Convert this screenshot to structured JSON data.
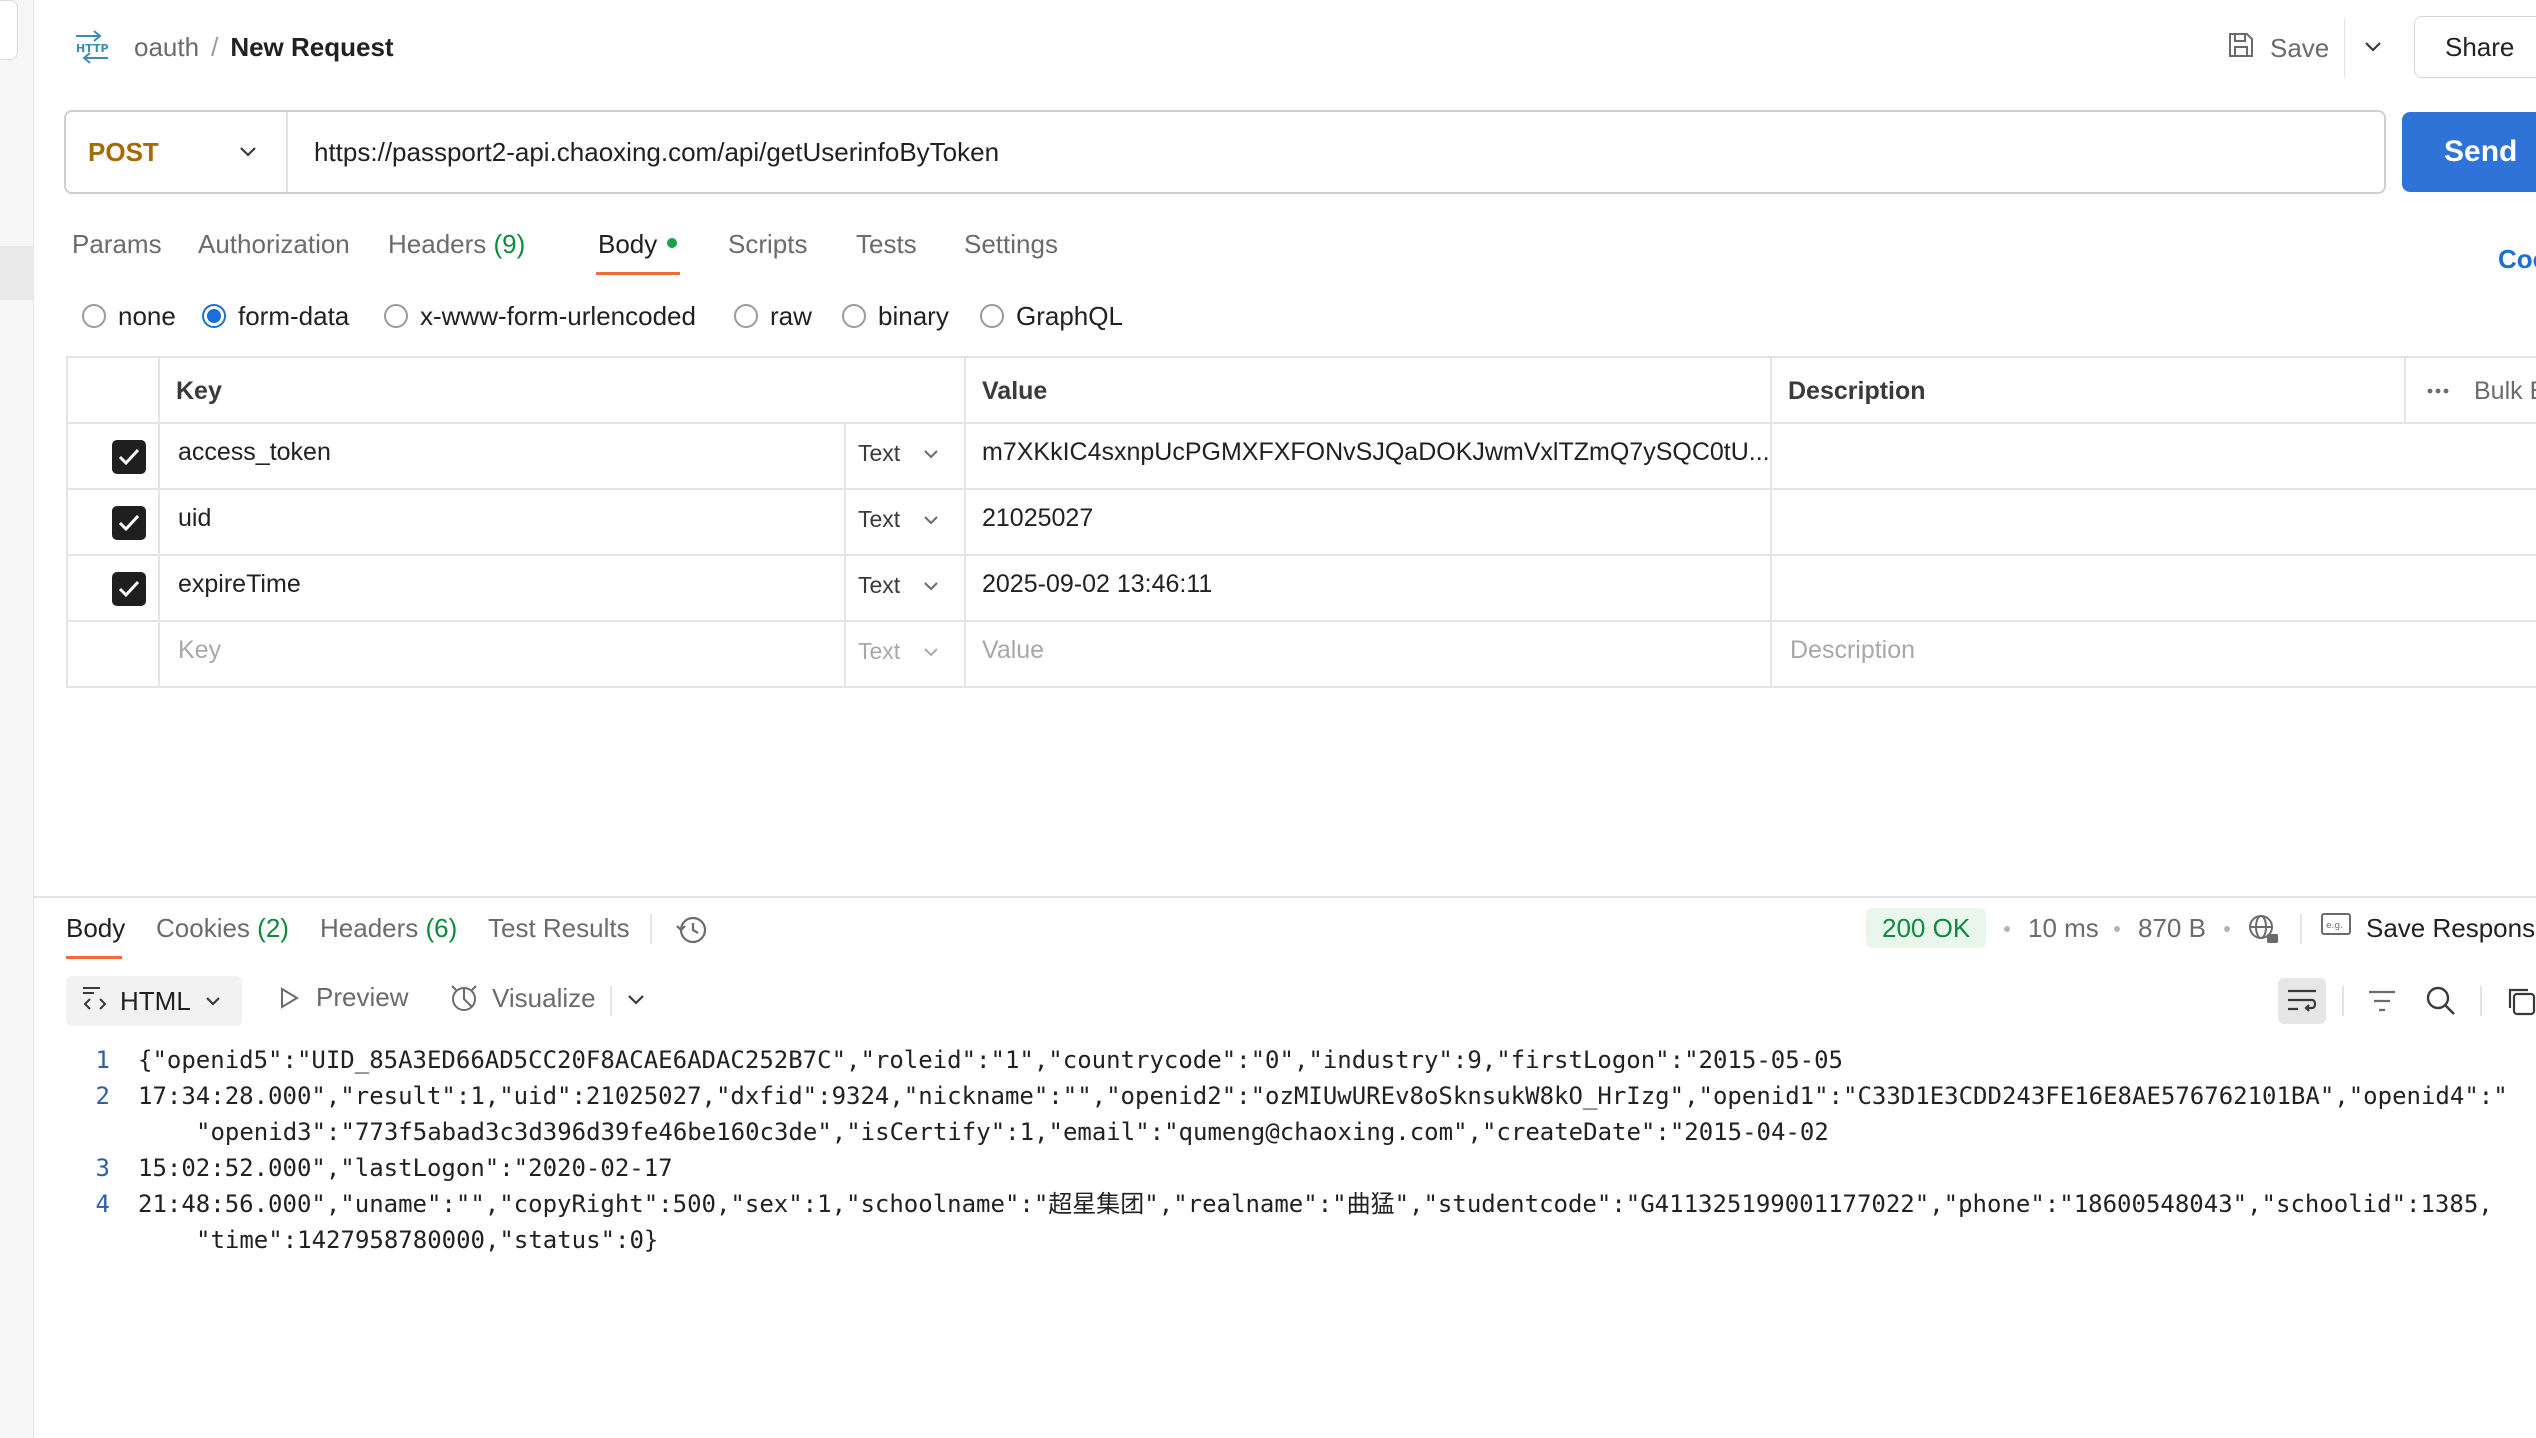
{
  "header": {
    "collection": "oauth",
    "separator": "/",
    "request_name": "New Request",
    "save_label": "Save",
    "share_label": "Share"
  },
  "request": {
    "method": "POST",
    "url": "https://passport2-api.chaoxing.com/api/getUserinfoByToken",
    "send_label": "Send"
  },
  "request_tabs": [
    {
      "label": "Params"
    },
    {
      "label": "Authorization"
    },
    {
      "label": "Headers",
      "count": "(9)"
    },
    {
      "label": "Body"
    },
    {
      "label": "Scripts"
    },
    {
      "label": "Tests"
    },
    {
      "label": "Settings"
    }
  ],
  "cookies_link": "Coo",
  "body_types": [
    "none",
    "form-data",
    "x-www-form-urlencoded",
    "raw",
    "binary",
    "GraphQL"
  ],
  "form_table": {
    "headers": {
      "key": "Key",
      "value": "Value",
      "description": "Description",
      "bulk_edit": "Bulk E"
    },
    "rows": [
      {
        "checked": true,
        "key": "access_token",
        "type": "Text",
        "value": "m7XKkIC4sxnpUcPGMXFXFONvSJQaDOKJwmVxlTZmQ7ySQC0tU..."
      },
      {
        "checked": true,
        "key": "uid",
        "type": "Text",
        "value": "21025027"
      },
      {
        "checked": true,
        "key": "expireTime",
        "type": "Text",
        "value": "2025-09-02 13:46:11"
      }
    ],
    "placeholder": {
      "key": "Key",
      "type": "Text",
      "value": "Value",
      "description": "Description"
    }
  },
  "response": {
    "tabs": [
      {
        "label": "Body"
      },
      {
        "label": "Cookies",
        "count": "(2)"
      },
      {
        "label": "Headers",
        "count": "(6)"
      },
      {
        "label": "Test Results"
      }
    ],
    "status": "200 OK",
    "time": "10 ms",
    "size": "870 B",
    "save_response_label": "Save Response",
    "format": "HTML",
    "preview_label": "Preview",
    "visualize_label": "Visualize",
    "lines": [
      {
        "n": "1",
        "text": "{\"openid5\":\"UID_85A3ED66AD5CC20F8ACAE6ADAC252B7C\",\"roleid\":\"1\",\"countrycode\":\"0\",\"industry\":9,\"firstLogon\":\"2015-05-05"
      },
      {
        "n": "2",
        "text": "17:34:28.000\",\"result\":1,\"uid\":21025027,\"dxfid\":9324,\"nickname\":\"\",\"openid2\":\"ozMIUwUREv8oSknsukW8kO_HrIzg\",\"openid1\":\"C33D1E3CDD243FE16E8AE576762101BA\",\"openid4\":\""
      },
      {
        "n": "",
        "text": "\"openid3\":\"773f5abad3c3d396d39fe46be160c3de\",\"isCertify\":1,\"email\":\"qumeng@chaoxing.com\",\"createDate\":\"2015-04-02"
      },
      {
        "n": "3",
        "text": "15:02:52.000\",\"lastLogon\":\"2020-02-17"
      },
      {
        "n": "4",
        "text": "21:48:56.000\",\"uname\":\"\",\"copyRight\":500,\"sex\":1,\"schoolname\":\"超星集团\",\"realname\":\"曲猛\",\"studentcode\":\"G411325199001177022\",\"phone\":\"18600548043\",\"schoolid\":1385,"
      },
      {
        "n": "",
        "text": "\"time\":1427958780000,\"status\":0}"
      }
    ]
  },
  "colors": {
    "accent": "#2f73d9",
    "method": "#a56a00",
    "active_tab_underline": "#f26b3a",
    "success": "#0d8a3c"
  },
  "icons": [
    "http-icon",
    "save-icon",
    "chevron-down-icon",
    "history-icon",
    "globe-icon",
    "save-response-icon",
    "code-icon",
    "play-icon",
    "visualize-icon",
    "wrap-icon",
    "filter-icon",
    "search-icon",
    "copy-icon",
    "more-icon",
    "checkbox-icon"
  ]
}
